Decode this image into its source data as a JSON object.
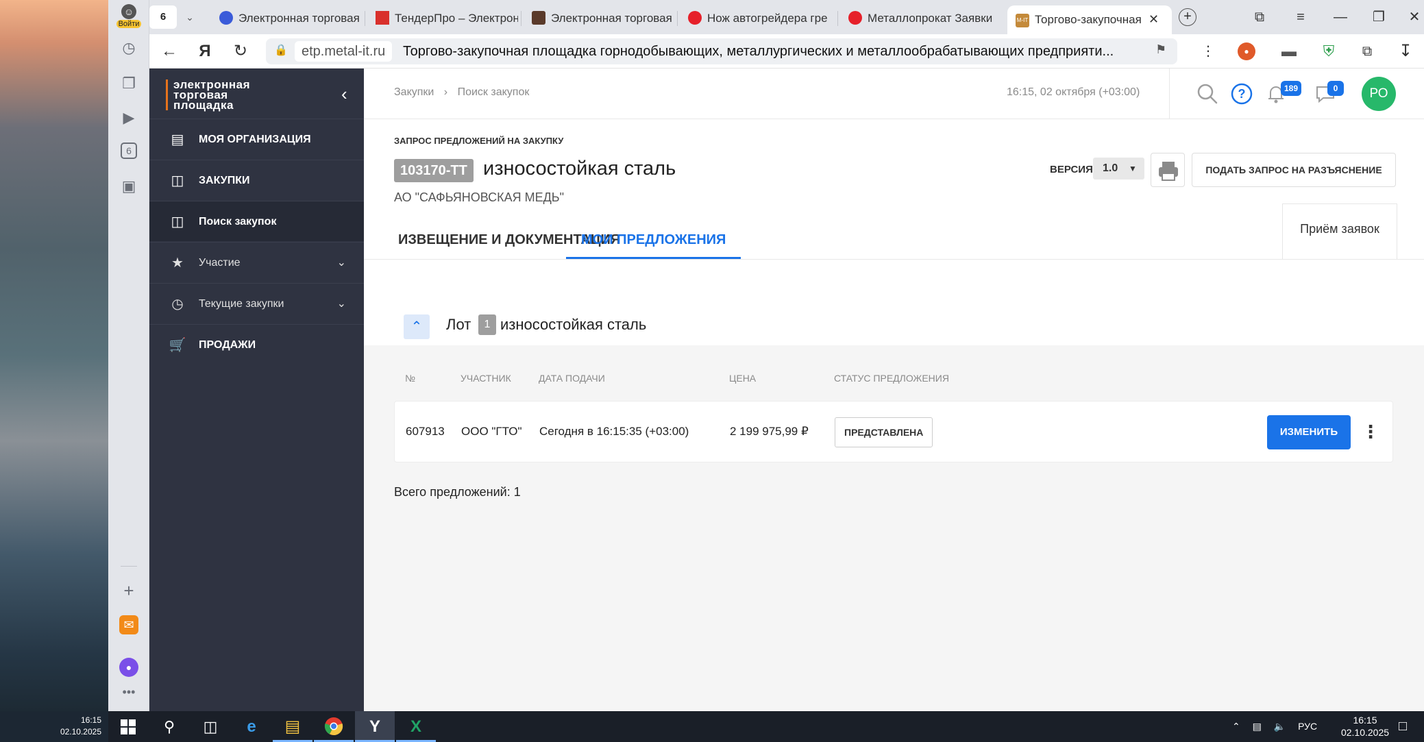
{
  "desktop": {
    "time": "16:15",
    "date": "02.10.2025"
  },
  "browser_side": {
    "login_label": "Войти",
    "tab_count": "6",
    "badge": "6"
  },
  "tabs": [
    {
      "title": "Электронная торговая",
      "fav": "#3a5bd9"
    },
    {
      "title": "ТендерПро – Электрон",
      "fav": "#d9302c"
    },
    {
      "title": "Электронная торговая",
      "fav": "#5a3a2a"
    },
    {
      "title": "Нож автогрейдера гре",
      "fav": "#e6202a"
    },
    {
      "title": "Металлопрокат Заявки",
      "fav": "#e6202a"
    },
    {
      "title": "Торгово-закупочная",
      "fav": "#c48a3a",
      "favtext": "M-IT"
    }
  ],
  "address": {
    "domain": "etp.metal-it.ru",
    "title": "Торгово-закупочная площадка горнодобывающих, металлургических и металлообрабатывающих предприяти..."
  },
  "sidebar": {
    "logo_lines": [
      "электронная",
      "торговая",
      "площадка"
    ],
    "items": [
      {
        "label": "МОЯ ОРГАНИЗАЦИЯ"
      },
      {
        "label": "ЗАКУПКИ"
      },
      {
        "label": "Поиск закупок"
      },
      {
        "label": "Участие"
      },
      {
        "label": "Текущие закупки"
      },
      {
        "label": "ПРОДАЖИ"
      }
    ]
  },
  "topbar": {
    "crumb1": "Закупки",
    "crumb_sep": "›",
    "crumb2": "Поиск закупок",
    "clock": "16:15, 02 октября (+03:00)",
    "notif_count": "189",
    "chat_count": "0",
    "avatar": "РО"
  },
  "procurement": {
    "label": "ЗАПРОС ПРЕДЛОЖЕНИЙ НА ЗАКУПКУ",
    "number": "103170-ТТ",
    "title": "износостойкая сталь",
    "org": "АО \"САФЬЯНОВСКАЯ МЕДЬ\"",
    "version_label": "ВЕРСИЯ",
    "version": "1.0",
    "ask_button": "ПОДАТЬ ЗАПРОС НА РАЗЪЯСНЕНИЕ",
    "tab1": "ИЗВЕЩЕНИЕ И ДОКУМЕНТАЦИЯ",
    "tab2": "МОИ ПРЕДЛОЖЕНИЯ",
    "status": "Приём заявок"
  },
  "lot": {
    "word": "Лот",
    "num": "1",
    "title": "износостойкая сталь"
  },
  "table": {
    "headers": [
      "№",
      "УЧАСТНИК",
      "ДАТА ПОДАЧИ",
      "ЦЕНА",
      "СТАТУС ПРЕДЛОЖЕНИЯ"
    ],
    "row": {
      "num": "607913",
      "participant": "ООО \"ГТО\"",
      "date": "Сегодня в 16:15:35 (+03:00)",
      "price": "2 199 975,99 ₽",
      "status": "ПРЕДСТАВЛЕНА"
    },
    "edit_button": "ИЗМЕНИТЬ"
  },
  "total": "Всего предложений: 1",
  "taskbar": {
    "lang": "РУС",
    "time": "16:15",
    "date": "02.10.2025"
  }
}
